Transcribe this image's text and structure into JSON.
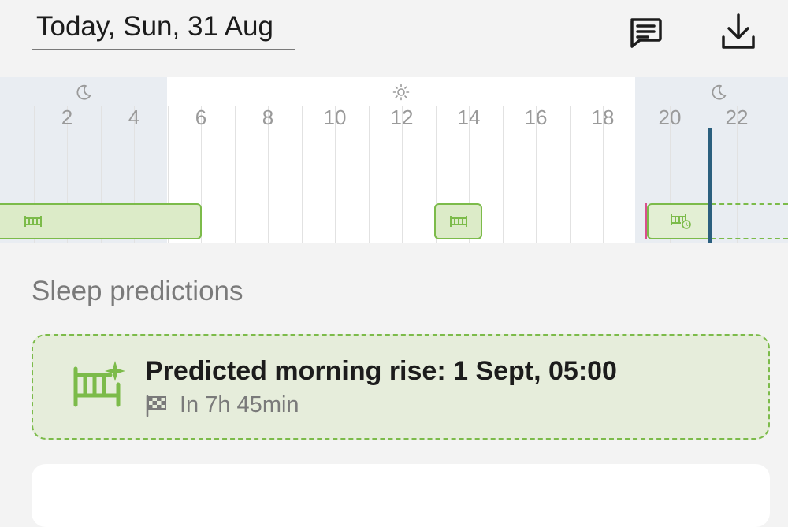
{
  "header": {
    "date_label": "Today, Sun, 31 Aug",
    "icons": [
      "notes-icon",
      "download-icon"
    ]
  },
  "timeline": {
    "hour_labels": [
      "2",
      "4",
      "6",
      "8",
      "10",
      "12",
      "14",
      "16",
      "18",
      "20",
      "22"
    ],
    "period_icons": [
      "moon-icon",
      "sun-icon",
      "moon-icon"
    ],
    "colors": {
      "night": "#e9edf2",
      "sleep_fill": "#dcebc8",
      "sleep_border": "#7cbb4a",
      "now_line": "#2b5f7e",
      "marker": "#d94f8e"
    }
  },
  "predictions": {
    "section_title": "Sleep predictions",
    "title": "Predicted morning rise: 1 Sept, 05:00",
    "subtitle": "In 7h 45min"
  }
}
